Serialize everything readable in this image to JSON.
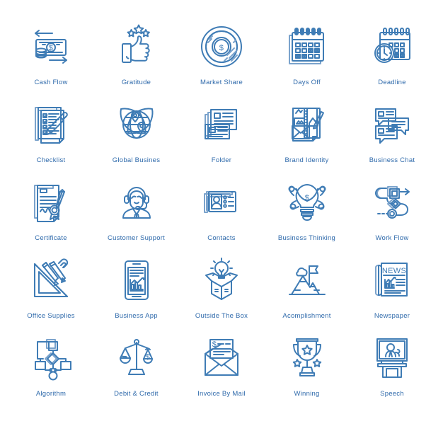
{
  "sheet": {
    "title": "Business Icons Set",
    "background_color": "#ffffff",
    "stroke_color": "#3f7cb5",
    "stroke_color_light": "#7ba3cc",
    "label_color": "#2f6aab",
    "columns": 5,
    "rows": 5,
    "total_icons": 25
  },
  "rows": [
    {
      "cells": [
        {
          "label": "Cash Flow",
          "icon": "cash-flow-icon"
        },
        {
          "label": "Gratitude",
          "icon": "gratitude-icon"
        },
        {
          "label": "Market Share",
          "icon": "market-share-icon"
        },
        {
          "label": "Days Off",
          "icon": "days-off-icon"
        },
        {
          "label": "Deadline",
          "icon": "deadline-icon"
        }
      ]
    },
    {
      "cells": [
        {
          "label": "Checklist",
          "icon": "checklist-icon"
        },
        {
          "label": "Global Busines",
          "icon": "global-business-icon"
        },
        {
          "label": "Folder",
          "icon": "folder-icon"
        },
        {
          "label": "Brand Identity",
          "icon": "brand-identity-icon"
        },
        {
          "label": "Business Chat",
          "icon": "business-chat-icon"
        }
      ]
    },
    {
      "cells": [
        {
          "label": "Certificate",
          "icon": "certificate-icon"
        },
        {
          "label": "Customer Support",
          "icon": "customer-support-icon"
        },
        {
          "label": "Contacts",
          "icon": "contacts-icon"
        },
        {
          "label": "Business Thinking",
          "icon": "business-thinking-icon"
        },
        {
          "label": "Work Flow",
          "icon": "work-flow-icon"
        }
      ]
    },
    {
      "cells": [
        {
          "label": "Office Supplies",
          "icon": "office-supplies-icon"
        },
        {
          "label": "Business App",
          "icon": "business-app-icon"
        },
        {
          "label": "Outside The Box",
          "icon": "outside-the-box-icon"
        },
        {
          "label": "Acomplishment",
          "icon": "acomplishment-icon"
        },
        {
          "label": "Newspaper",
          "icon": "newspaper-icon"
        }
      ]
    },
    {
      "cells": [
        {
          "label": "Algorithm",
          "icon": "algorithm-icon"
        },
        {
          "label": "Debit & Credit",
          "icon": "debit-and-credit-icon"
        },
        {
          "label": "Invoice By Mail",
          "icon": "invoice-by-mail-icon"
        },
        {
          "label": "Winning",
          "icon": "winning-icon"
        },
        {
          "label": "Speech",
          "icon": "speech-icon"
        }
      ]
    }
  ],
  "glyph_text": {
    "dollar_sign": "$",
    "newspaper_masthead": "NEWS"
  }
}
